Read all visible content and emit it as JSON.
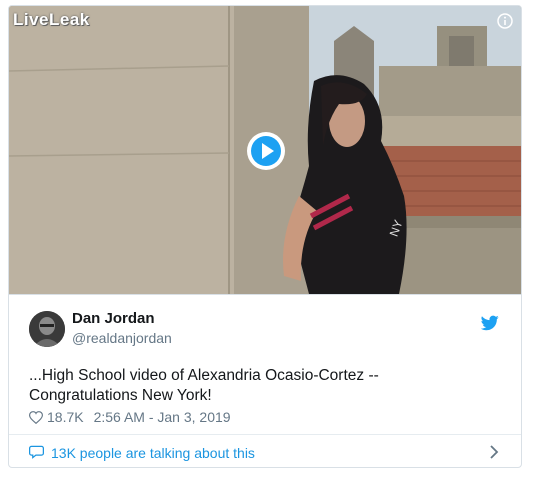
{
  "media": {
    "watermark": "LiveLeak",
    "play_icon": "play-icon",
    "info_icon": "info-icon"
  },
  "tweet": {
    "author_name": "Dan Jordan",
    "author_handle": "@realdanjordan",
    "text_line1": "...High School video of Alexandria Ocasio-Cortez --",
    "text_line2": "Congratulations New York!",
    "likes": "18.7K",
    "timestamp": "2:56 AM - Jan 3, 2019",
    "talking": "13K people are talking about this"
  },
  "colors": {
    "accent": "#1b95e0",
    "text": "#14171a",
    "muted": "#657786",
    "border": "#d9e0e6"
  }
}
